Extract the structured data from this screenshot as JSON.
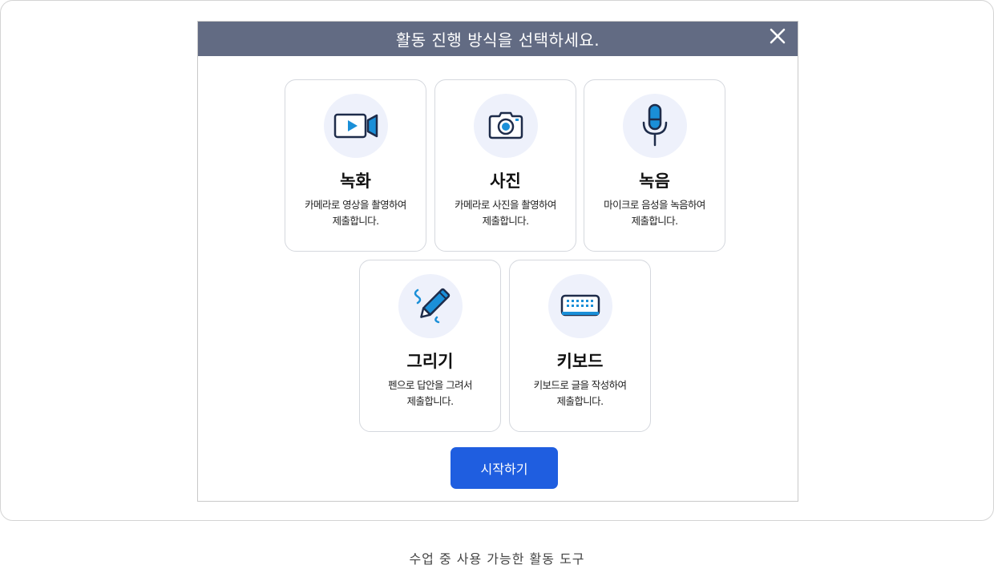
{
  "dialog": {
    "title": "활동 진행 방식을 선택하세요.",
    "close_icon": "close-icon"
  },
  "options": [
    {
      "icon": "video-camera-icon",
      "title": "녹화",
      "desc_line1": "카메라로 영상을 촬영하여",
      "desc_line2": "제출합니다."
    },
    {
      "icon": "photo-camera-icon",
      "title": "사진",
      "desc_line1": "카메라로 사진을 촬영하여",
      "desc_line2": "제출합니다."
    },
    {
      "icon": "microphone-icon",
      "title": "녹음",
      "desc_line1": "마이크로 음성을 녹음하여",
      "desc_line2": "제출합니다."
    },
    {
      "icon": "pen-icon",
      "title": "그리기",
      "desc_line1": "펜으로 답안을 그려서",
      "desc_line2": "제출합니다."
    },
    {
      "icon": "keyboard-icon",
      "title": "키보드",
      "desc_line1": "키보드로 글을 작성하여",
      "desc_line2": "제출합니다."
    }
  ],
  "start_button": {
    "label": "시작하기"
  },
  "caption": "수업 중 사용 가능한 활동 도구",
  "colors": {
    "header_bg": "#626b83",
    "primary": "#1f5ee0",
    "icon_bg": "#eef1fb",
    "icon_accent": "#1a8fd8"
  }
}
